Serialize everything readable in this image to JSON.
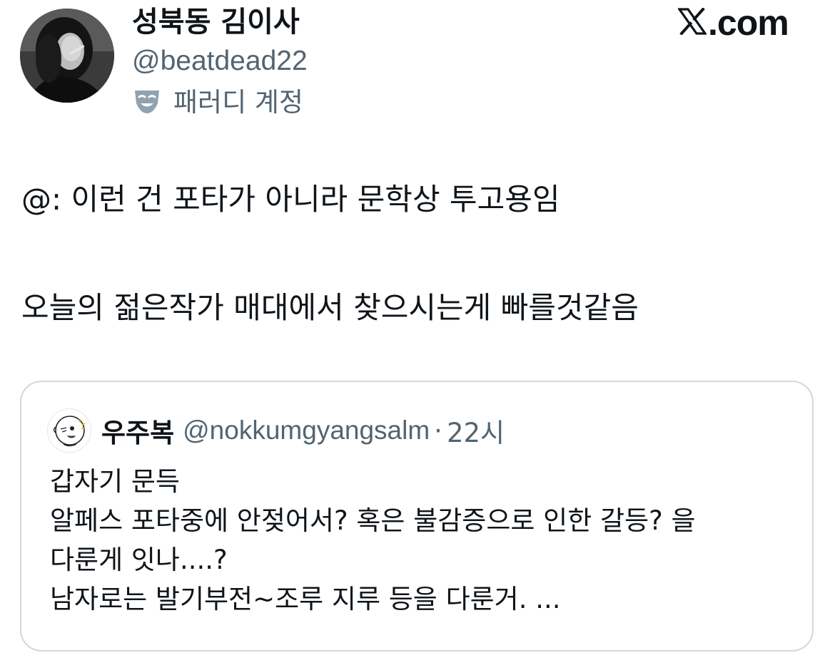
{
  "author": {
    "display_name": "성북동 김이사",
    "handle": "@beatdead22",
    "badge_label": "패러디 계정",
    "badge_icon": "parody-mask-icon"
  },
  "brand": {
    "logo_icon": "x-logo-icon",
    "text": ".com"
  },
  "tweet": {
    "lines": [
      "@: 이런 건 포타가 아니라 문학상 투고용임",
      "오늘의 젊은작가 매대에서 찾으시는게 빠를것같음"
    ]
  },
  "quote": {
    "name": "우주복",
    "handle": "@nokkumgyangsalm",
    "separator": "·",
    "time": "22시",
    "lines": [
      "갑자기 문득",
      "알페스 포타중에 안젖어서? 혹은 불감증으로 인한 갈등? 을",
      "다룬게 잇나....?",
      "남자로는 발기부전~조루 지루 등을 다룬거. ..."
    ]
  },
  "colors": {
    "text_primary": "#0f1419",
    "text_secondary": "#536471",
    "card_border": "#cfd9de"
  }
}
